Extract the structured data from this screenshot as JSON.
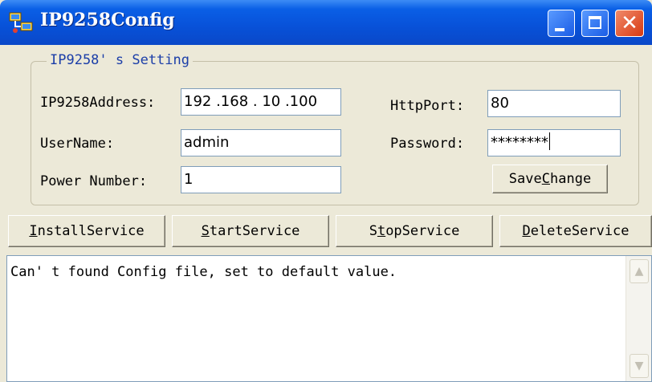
{
  "window": {
    "title": "IP9258Config"
  },
  "group": {
    "title": "IP9258' s Setting"
  },
  "fields": {
    "ip_label": "IP9258Address:",
    "ip_value": "192 .168 . 10  .100",
    "port_label": "HttpPort:",
    "port_value": "80",
    "user_label": "UserName:",
    "user_value": "admin",
    "pass_label": "Password:",
    "pass_value": "********",
    "power_label": "Power Number:",
    "power_value": "1"
  },
  "buttons": {
    "save_pre": "Save",
    "save_hot": "C",
    "save_post": "hange",
    "install_pre": "",
    "install_hot": "I",
    "install_post": "nstallService",
    "start_pre": "",
    "start_hot": "S",
    "start_post": "tartService",
    "stop_pre": "S",
    "stop_hot": "t",
    "stop_post": "opService",
    "delete_pre": "",
    "delete_hot": "D",
    "delete_post": "eleteService"
  },
  "output": {
    "text": "Can' t found Config file, set to default value."
  },
  "scrollbar": {
    "up_icon": "▲",
    "down_icon": "▼"
  },
  "colors": {
    "title_bar": "#0a5fe6",
    "close_button": "#d83a12",
    "group_title": "#1b3ea8",
    "window_bg": "#ece9d8"
  }
}
